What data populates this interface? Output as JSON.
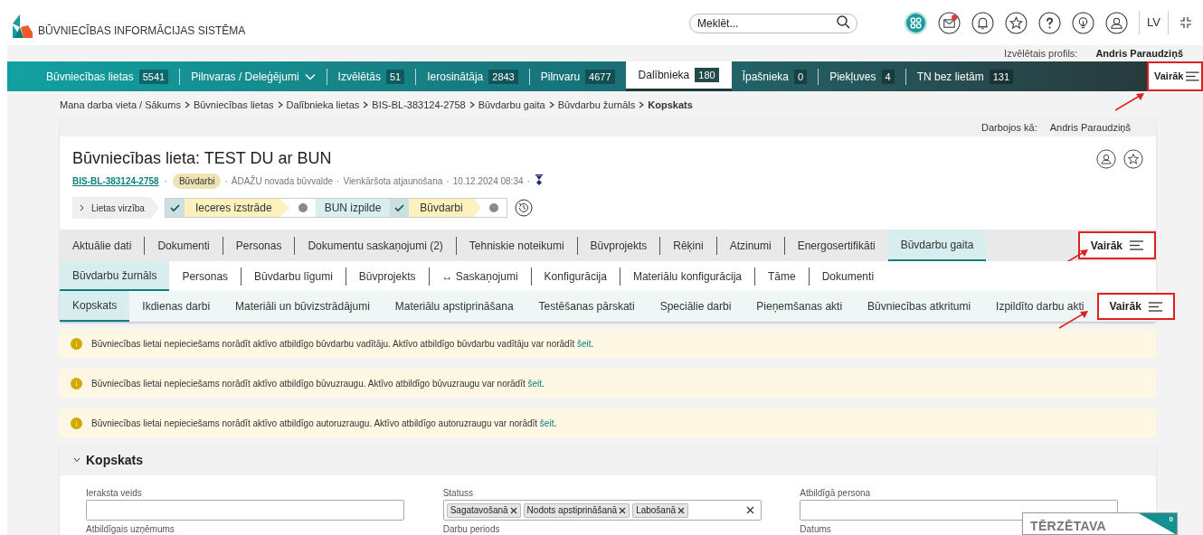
{
  "header": {
    "logo_text": "BŪVNIECĪBAS INFORMĀCIJAS SISTĒMA",
    "search": {
      "placeholder": "Meklēt..."
    },
    "icons": [
      {
        "kind": "apps",
        "highlighted": true,
        "badge": false
      },
      {
        "kind": "mail",
        "highlighted": false,
        "badge": true
      },
      {
        "kind": "bell",
        "highlighted": false,
        "badge": false
      },
      {
        "kind": "star",
        "highlighted": false,
        "badge": false
      },
      {
        "kind": "help",
        "highlighted": false,
        "badge": false
      },
      {
        "kind": "bulb",
        "highlighted": false,
        "badge": false
      },
      {
        "kind": "user",
        "highlighted": false,
        "badge": false
      }
    ],
    "language": "LV",
    "profile_label": "Izvēlētais profils:",
    "profile_name": "Andris Paraudziņš"
  },
  "nav": {
    "items": [
      {
        "kind": "count",
        "label": "Būvniecības lietas",
        "count": "5541",
        "selected": false
      },
      {
        "kind": "menu",
        "label": "Pilnvaras / Deleģējumi",
        "selected": false
      },
      {
        "kind": "count",
        "label": "Izvēlētās",
        "count": "51",
        "selected": false
      },
      {
        "kind": "count",
        "label": "Ierosinātāja",
        "count": "2843",
        "selected": false
      },
      {
        "kind": "count",
        "label": "Pilnvaru",
        "count": "4677",
        "selected": false
      },
      {
        "kind": "count",
        "label": "Dalībnieka",
        "count": "180",
        "selected": true
      },
      {
        "kind": "count",
        "label": "Īpašnieka",
        "count": "0",
        "selected": false
      },
      {
        "kind": "count",
        "label": "Piekļuves",
        "count": "4",
        "selected": false
      },
      {
        "kind": "count",
        "label": "TN bez lietām",
        "count": "131",
        "selected": false
      }
    ],
    "more": {
      "label": "Vairāk",
      "annotated": true
    }
  },
  "breadcrumb": [
    "Mana darba vieta / Sākums",
    "Būvniecības lietas",
    "Dalībnieka lietas",
    "BIS-BL-383124-2758",
    "Būvdarbu gaita",
    "Būvdarbu žurnāls",
    "Kopskats"
  ],
  "case": {
    "acting_label": "Darbojos kā:",
    "acting_name": "Andris Paraudziņš",
    "title": "Būvniecības lieta: TEST DU ar BUN",
    "id_link": "BIS-BL-383124-2758",
    "stage": "Būvdarbi",
    "separator": "·",
    "meta": [
      "ĀDAŽU novada būvvalde",
      "Vienkāršota atjaunošana",
      "10.12.2024 08:34"
    ],
    "progress": {
      "toggle": "Lietas virzība",
      "steps": [
        {
          "label": "Ieceres izstrāde",
          "kind": "done"
        },
        {
          "label": "BUN izpilde",
          "kind": "current"
        },
        {
          "label": "Būvdarbi",
          "kind": "done"
        }
      ]
    }
  },
  "tabs_1": {
    "items": [
      {
        "label": "Aktuālie dati",
        "selected": false
      },
      {
        "label": "Dokumenti",
        "selected": false
      },
      {
        "label": "Personas",
        "selected": false
      },
      {
        "label": "Dokumentu saskaņojumi (2)",
        "selected": false
      },
      {
        "label": "Tehniskie noteikumi",
        "selected": false
      },
      {
        "label": "Būvprojekts",
        "selected": false
      },
      {
        "label": "Rēķini",
        "selected": false
      },
      {
        "label": "Atzinumi",
        "selected": false
      },
      {
        "label": "Energosertifikāti",
        "selected": false
      },
      {
        "label": "Būvdarbu gaita",
        "selected": true
      }
    ],
    "more": {
      "label": "Vairāk",
      "annotated": true
    }
  },
  "tabs_2": {
    "items": [
      {
        "label": "Būvdarbu žurnāls",
        "selected": true
      },
      {
        "label": "Personas",
        "selected": false
      },
      {
        "label": "Būvdarbu līgumi",
        "selected": false
      },
      {
        "label": "Būvprojekts",
        "selected": false
      },
      {
        "label": "↔ Saskaņojumi",
        "selected": false
      },
      {
        "label": "Konfigurācija",
        "selected": false
      },
      {
        "label": "Materiālu konfigurācija",
        "selected": false
      },
      {
        "label": "Tāme",
        "selected": false
      },
      {
        "label": "Dokumenti",
        "selected": false
      }
    ]
  },
  "tabs_3": {
    "items": [
      {
        "label": "Kopskats",
        "selected": true
      },
      {
        "label": "Ikdienas darbi",
        "selected": false
      },
      {
        "label": "Materiāli un būvizstrādājumi",
        "selected": false
      },
      {
        "label": "Materiālu apstiprināšana",
        "selected": false
      },
      {
        "label": "Testēšanas pārskati",
        "selected": false
      },
      {
        "label": "Speciālie darbi",
        "selected": false
      },
      {
        "label": "Pieņemšanas akti",
        "selected": false
      },
      {
        "label": "Būvniecības atkritumi",
        "selected": false
      },
      {
        "label": "Izpildīto darbu akti",
        "selected": false
      }
    ],
    "more": {
      "label": "Vairāk",
      "annotated": true
    }
  },
  "alerts": [
    {
      "text": "Būvniecības lietai nepieciešams norādīt aktīvo atbildīgo būvdarbu vadītāju. Aktīvo atbildīgo būvdarbu vadītāju var norādīt",
      "link": "šeit",
      "end": "."
    },
    {
      "text": "Būvniecības lietai nepieciešams norādīt aktīvo atbildīgo būvuzraugu. Aktīvo atbildīgo būvuzraugu var norādīt",
      "link": "šeit",
      "end": "."
    },
    {
      "text": "Būvniecības lietai nepieciešams norādīt aktīvo atbildīgo autoruzraugu. Aktīvo atbildīgo autoruzraugu var norādīt",
      "link": "šeit",
      "end": "."
    }
  ],
  "panel": {
    "title": "Kopskats",
    "expanded": true,
    "fields": [
      {
        "kind": "text",
        "label": "Ieraksta veids"
      },
      {
        "kind": "tags",
        "label": "Statuss",
        "tags": [
          "Sagatavošanā",
          "Nodots apstiprināšanā",
          "Labošanā"
        ]
      },
      {
        "kind": "text",
        "label": "Atbildīgā persona"
      },
      {
        "kind": "label",
        "label": "Atbildīgais uzņēmums"
      },
      {
        "kind": "label",
        "label": "Darbu periods"
      },
      {
        "kind": "label",
        "label": "Datums"
      }
    ]
  },
  "chat": {
    "title": "TĒRZĒTAVA",
    "count": "0"
  }
}
